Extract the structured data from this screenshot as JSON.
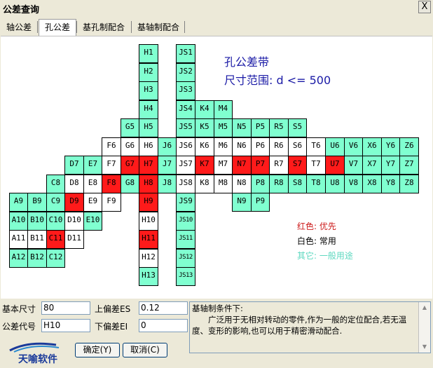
{
  "window": {
    "title": "公差查询",
    "close_label": "X"
  },
  "tabs": [
    {
      "label": "轴公差",
      "active": false
    },
    {
      "label": "孔公差",
      "active": true
    },
    {
      "label": "基孔制配合",
      "active": false
    },
    {
      "label": "基轴制配合",
      "active": false
    }
  ],
  "band": {
    "title": "孔公差带",
    "range": "尺寸范围: d <= 500"
  },
  "legend": [
    {
      "text": "红色: 优先",
      "color": "#cc1a1a"
    },
    {
      "text": "白色: 常用",
      "color": "#000000"
    },
    {
      "text": "其它: 一般用途",
      "color": "#5ed8c0"
    }
  ],
  "colors": {
    "green": "#80ffd0",
    "red": "#ff1a1a",
    "white": "#ffffff",
    "title_blue": "#1a1aa6"
  },
  "grid": {
    "col_letters": [
      "A",
      "B",
      "C",
      "D",
      "E",
      "F",
      "G",
      "H",
      "J",
      "JS",
      "K",
      "M",
      "N",
      "P",
      "R",
      "S",
      "T",
      "U",
      "V",
      "X",
      "Y",
      "Z"
    ],
    "cells": [
      {
        "label": "H1",
        "col": "H",
        "row": 1,
        "color": "g"
      },
      {
        "label": "H2",
        "col": "H",
        "row": 2,
        "color": "g"
      },
      {
        "label": "H3",
        "col": "H",
        "row": 3,
        "color": "g"
      },
      {
        "label": "H4",
        "col": "H",
        "row": 4,
        "color": "g"
      },
      {
        "label": "H5",
        "col": "H",
        "row": 5,
        "color": "g"
      },
      {
        "label": "H6",
        "col": "H",
        "row": 6,
        "color": "w"
      },
      {
        "label": "H7",
        "col": "H",
        "row": 7,
        "color": "r"
      },
      {
        "label": "H8",
        "col": "H",
        "row": 8,
        "color": "r"
      },
      {
        "label": "H9",
        "col": "H",
        "row": 9,
        "color": "r"
      },
      {
        "label": "H10",
        "col": "H",
        "row": 10,
        "color": "w"
      },
      {
        "label": "H11",
        "col": "H",
        "row": 11,
        "color": "r"
      },
      {
        "label": "H12",
        "col": "H",
        "row": 12,
        "color": "w"
      },
      {
        "label": "H13",
        "col": "H",
        "row": 13,
        "color": "g"
      },
      {
        "label": "JS1",
        "col": "JS",
        "row": 1,
        "color": "g"
      },
      {
        "label": "JS2",
        "col": "JS",
        "row": 2,
        "color": "g"
      },
      {
        "label": "JS3",
        "col": "JS",
        "row": 3,
        "color": "g"
      },
      {
        "label": "JS4",
        "col": "JS",
        "row": 4,
        "color": "g"
      },
      {
        "label": "JS5",
        "col": "JS",
        "row": 5,
        "color": "g"
      },
      {
        "label": "JS6",
        "col": "JS",
        "row": 6,
        "color": "w"
      },
      {
        "label": "JS7",
        "col": "JS",
        "row": 7,
        "color": "w"
      },
      {
        "label": "JS8",
        "col": "JS",
        "row": 8,
        "color": "w"
      },
      {
        "label": "JS9",
        "col": "JS",
        "row": 9,
        "color": "g"
      },
      {
        "label": "JS10",
        "col": "JS",
        "row": 10,
        "color": "g"
      },
      {
        "label": "JS11",
        "col": "JS",
        "row": 11,
        "color": "g"
      },
      {
        "label": "JS12",
        "col": "JS",
        "row": 12,
        "color": "g"
      },
      {
        "label": "JS13",
        "col": "JS",
        "row": 13,
        "color": "g"
      },
      {
        "label": "K4",
        "col": "K",
        "row": 4,
        "color": "g"
      },
      {
        "label": "M4",
        "col": "M",
        "row": 4,
        "color": "g"
      },
      {
        "label": "G5",
        "col": "G",
        "row": 5,
        "color": "g"
      },
      {
        "label": "K5",
        "col": "K",
        "row": 5,
        "color": "g"
      },
      {
        "label": "M5",
        "col": "M",
        "row": 5,
        "color": "g"
      },
      {
        "label": "N5",
        "col": "N",
        "row": 5,
        "color": "g"
      },
      {
        "label": "P5",
        "col": "P",
        "row": 5,
        "color": "g"
      },
      {
        "label": "R5",
        "col": "R",
        "row": 5,
        "color": "g"
      },
      {
        "label": "S5",
        "col": "S",
        "row": 5,
        "color": "g"
      },
      {
        "label": "F6",
        "col": "F",
        "row": 6,
        "color": "w"
      },
      {
        "label": "G6",
        "col": "G",
        "row": 6,
        "color": "w"
      },
      {
        "label": "J6",
        "col": "J",
        "row": 6,
        "color": "g"
      },
      {
        "label": "K6",
        "col": "K",
        "row": 6,
        "color": "w"
      },
      {
        "label": "M6",
        "col": "M",
        "row": 6,
        "color": "w"
      },
      {
        "label": "N6",
        "col": "N",
        "row": 6,
        "color": "w"
      },
      {
        "label": "P6",
        "col": "P",
        "row": 6,
        "color": "w"
      },
      {
        "label": "R6",
        "col": "R",
        "row": 6,
        "color": "w"
      },
      {
        "label": "S6",
        "col": "S",
        "row": 6,
        "color": "w"
      },
      {
        "label": "T6",
        "col": "T",
        "row": 6,
        "color": "w"
      },
      {
        "label": "U6",
        "col": "U",
        "row": 6,
        "color": "g"
      },
      {
        "label": "V6",
        "col": "V",
        "row": 6,
        "color": "g"
      },
      {
        "label": "X6",
        "col": "X",
        "row": 6,
        "color": "g"
      },
      {
        "label": "Y6",
        "col": "Y",
        "row": 6,
        "color": "g"
      },
      {
        "label": "Z6",
        "col": "Z",
        "row": 6,
        "color": "g"
      },
      {
        "label": "D7",
        "col": "D",
        "row": 7,
        "color": "g"
      },
      {
        "label": "E7",
        "col": "E",
        "row": 7,
        "color": "g"
      },
      {
        "label": "F7",
        "col": "F",
        "row": 7,
        "color": "w"
      },
      {
        "label": "G7",
        "col": "G",
        "row": 7,
        "color": "r"
      },
      {
        "label": "J7",
        "col": "J",
        "row": 7,
        "color": "g"
      },
      {
        "label": "K7",
        "col": "K",
        "row": 7,
        "color": "r"
      },
      {
        "label": "M7",
        "col": "M",
        "row": 7,
        "color": "w"
      },
      {
        "label": "N7",
        "col": "N",
        "row": 7,
        "color": "r"
      },
      {
        "label": "P7",
        "col": "P",
        "row": 7,
        "color": "r"
      },
      {
        "label": "R7",
        "col": "R",
        "row": 7,
        "color": "w"
      },
      {
        "label": "S7",
        "col": "S",
        "row": 7,
        "color": "r"
      },
      {
        "label": "T7",
        "col": "T",
        "row": 7,
        "color": "w"
      },
      {
        "label": "U7",
        "col": "U",
        "row": 7,
        "color": "r"
      },
      {
        "label": "V7",
        "col": "V",
        "row": 7,
        "color": "g"
      },
      {
        "label": "X7",
        "col": "X",
        "row": 7,
        "color": "g"
      },
      {
        "label": "Y7",
        "col": "Y",
        "row": 7,
        "color": "g"
      },
      {
        "label": "Z7",
        "col": "Z",
        "row": 7,
        "color": "g"
      },
      {
        "label": "C8",
        "col": "C",
        "row": 8,
        "color": "g"
      },
      {
        "label": "D8",
        "col": "D",
        "row": 8,
        "color": "w"
      },
      {
        "label": "E8",
        "col": "E",
        "row": 8,
        "color": "w"
      },
      {
        "label": "F8",
        "col": "F",
        "row": 8,
        "color": "r"
      },
      {
        "label": "G8",
        "col": "G",
        "row": 8,
        "color": "g"
      },
      {
        "label": "J8",
        "col": "J",
        "row": 8,
        "color": "g"
      },
      {
        "label": "K8",
        "col": "K",
        "row": 8,
        "color": "w"
      },
      {
        "label": "M8",
        "col": "M",
        "row": 8,
        "color": "w"
      },
      {
        "label": "N8",
        "col": "N",
        "row": 8,
        "color": "w"
      },
      {
        "label": "P8",
        "col": "P",
        "row": 8,
        "color": "g"
      },
      {
        "label": "R8",
        "col": "R",
        "row": 8,
        "color": "g"
      },
      {
        "label": "S8",
        "col": "S",
        "row": 8,
        "color": "g"
      },
      {
        "label": "T8",
        "col": "T",
        "row": 8,
        "color": "g"
      },
      {
        "label": "U8",
        "col": "U",
        "row": 8,
        "color": "g"
      },
      {
        "label": "V8",
        "col": "V",
        "row": 8,
        "color": "g"
      },
      {
        "label": "X8",
        "col": "X",
        "row": 8,
        "color": "g"
      },
      {
        "label": "Y8",
        "col": "Y",
        "row": 8,
        "color": "g"
      },
      {
        "label": "Z8",
        "col": "Z",
        "row": 8,
        "color": "g"
      },
      {
        "label": "A9",
        "col": "A",
        "row": 9,
        "color": "g"
      },
      {
        "label": "B9",
        "col": "B",
        "row": 9,
        "color": "g"
      },
      {
        "label": "C9",
        "col": "C",
        "row": 9,
        "color": "g"
      },
      {
        "label": "D9",
        "col": "D",
        "row": 9,
        "color": "r"
      },
      {
        "label": "E9",
        "col": "E",
        "row": 9,
        "color": "w"
      },
      {
        "label": "F9",
        "col": "F",
        "row": 9,
        "color": "w"
      },
      {
        "label": "N9",
        "col": "N",
        "row": 9,
        "color": "g"
      },
      {
        "label": "P9",
        "col": "P",
        "row": 9,
        "color": "g"
      },
      {
        "label": "A10",
        "col": "A",
        "row": 10,
        "color": "g"
      },
      {
        "label": "B10",
        "col": "B",
        "row": 10,
        "color": "g"
      },
      {
        "label": "C10",
        "col": "C",
        "row": 10,
        "color": "g"
      },
      {
        "label": "D10",
        "col": "D",
        "row": 10,
        "color": "w"
      },
      {
        "label": "E10",
        "col": "E",
        "row": 10,
        "color": "g"
      },
      {
        "label": "A11",
        "col": "A",
        "row": 11,
        "color": "w"
      },
      {
        "label": "B11",
        "col": "B",
        "row": 11,
        "color": "w"
      },
      {
        "label": "C11",
        "col": "C",
        "row": 11,
        "color": "r"
      },
      {
        "label": "D11",
        "col": "D",
        "row": 11,
        "color": "w"
      },
      {
        "label": "A12",
        "col": "A",
        "row": 12,
        "color": "g"
      },
      {
        "label": "B12",
        "col": "B",
        "row": 12,
        "color": "g"
      },
      {
        "label": "C12",
        "col": "C",
        "row": 12,
        "color": "g"
      }
    ]
  },
  "form": {
    "basic_size_label": "基本尺寸",
    "basic_size_value": "80",
    "upper_dev_label": "上偏差ES",
    "upper_dev_value": "0.12",
    "code_label": "公差代号",
    "code_value": "H10",
    "lower_dev_label": "下偏差EI",
    "lower_dev_value": "0"
  },
  "description": {
    "heading": "基轴制条件下:",
    "text": "广泛用于无相对转动的零件,作为一般的定位配合,若无温度、变形的影响,也可以用于精密滑动配合."
  },
  "buttons": {
    "ok": "确定(Y)",
    "cancel": "取消(C)"
  },
  "logo": {
    "text": "天喻软件"
  }
}
